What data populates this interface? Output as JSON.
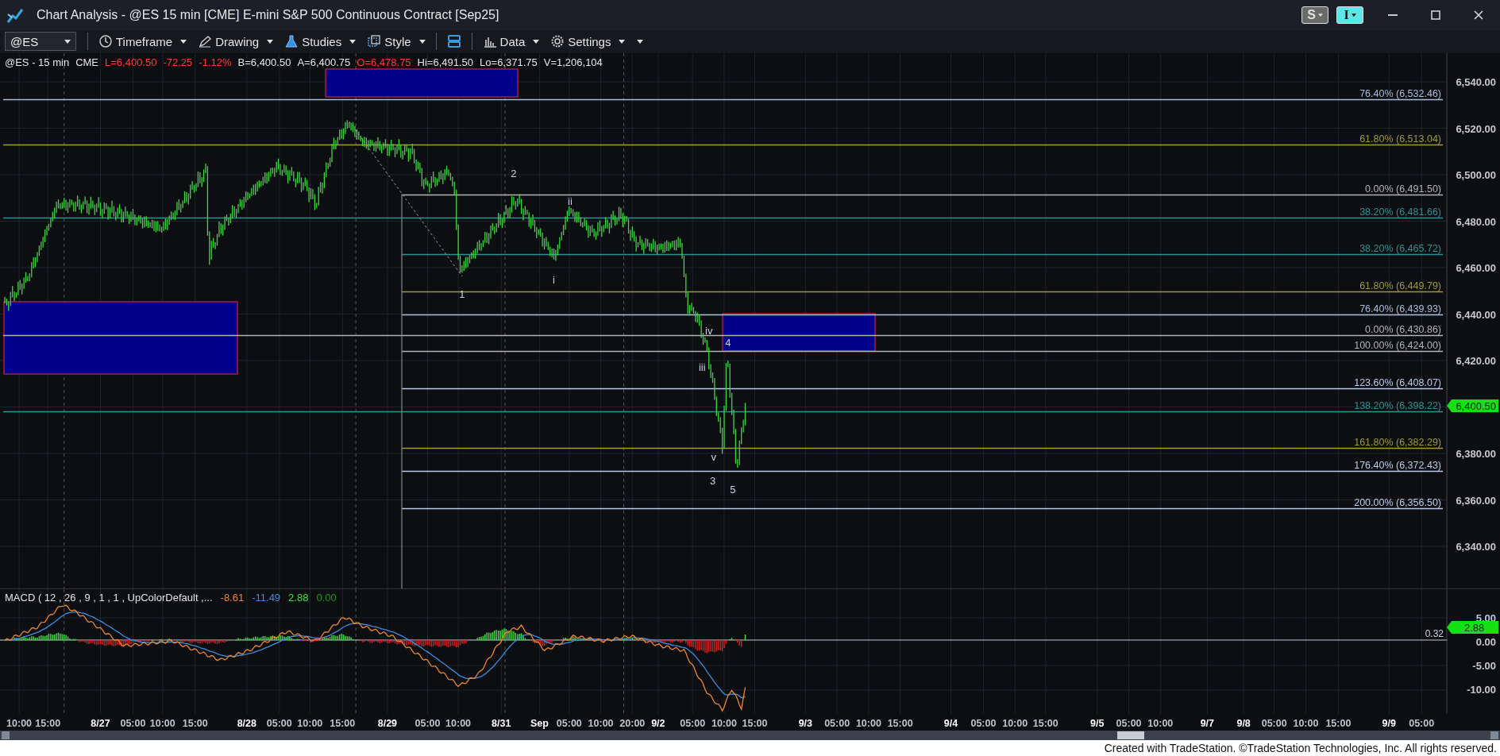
{
  "window": {
    "title": "Chart Analysis - @ES 15 min [CME] E-mini S&P 500 Continuous Contract [Sep25]",
    "buttons": [
      {
        "label": "S",
        "kind": "grey"
      },
      {
        "label": "I",
        "kind": "cyan"
      }
    ]
  },
  "toolbar": {
    "symbol": "@ES",
    "items": [
      {
        "label": "Timeframe",
        "kind": "clock"
      },
      {
        "label": "Drawing",
        "kind": "pen"
      },
      {
        "label": "Studies",
        "kind": "flask"
      },
      {
        "label": "Style",
        "kind": "style"
      },
      {
        "kind": "layout"
      },
      {
        "label": "Data",
        "kind": "data"
      },
      {
        "label": "Settings",
        "kind": "gear"
      }
    ]
  },
  "info_line": [
    {
      "text": "@ES - 15 min",
      "color": "#e6e6e6"
    },
    {
      "text": "CME",
      "color": "#e6e6e6"
    },
    {
      "text": "L=6,400.50",
      "color": "#ff3b3b"
    },
    {
      "text": "-72.25",
      "color": "#ff3b3b"
    },
    {
      "text": "-1.12%",
      "color": "#ff3b3b"
    },
    {
      "text": "B=6,400.50",
      "color": "#e6e6e6"
    },
    {
      "text": "A=6,400.75",
      "color": "#e6e6e6"
    },
    {
      "text": "O=6,478.75",
      "color": "#ff3b3b"
    },
    {
      "text": "Hi=6,491.50",
      "color": "#e6e6e6"
    },
    {
      "text": "Lo=6,371.75",
      "color": "#e6e6e6"
    },
    {
      "text": "V=1,206,104",
      "color": "#e6e6e6"
    }
  ],
  "price_axis": {
    "ticks": [
      "6,540.00",
      "6,520.00",
      "6,500.00",
      "6,480.00",
      "6,460.00",
      "6,440.00",
      "6,420.00",
      "6,380.00",
      "6,360.00",
      "6,340.00"
    ],
    "last_price": "6,400.50"
  },
  "fib_levels": [
    {
      "label": "76.40% (6,532.46)",
      "color": "#a9bcd8",
      "kind": "wide"
    },
    {
      "label": "61.80% (6,513.04)",
      "color": "#a09a30",
      "kind": "wide"
    },
    {
      "label": "0.00% (6,491.50)",
      "color": "#b4b4b4",
      "kind": "partial"
    },
    {
      "label": "38.20% (6,481.66)",
      "color": "#2a9494",
      "kind": "wide"
    },
    {
      "label": "38.20% (6,465.72)",
      "color": "#2a9494",
      "kind": "partial"
    },
    {
      "label": "61.80% (6,449.79)",
      "color": "#a09a30",
      "kind": "partial"
    },
    {
      "label": "76.40% (6,439.93)",
      "color": "#a9bcd8",
      "kind": "partial"
    },
    {
      "label": "0.00% (6,430.86)",
      "color": "#b4b4b4",
      "kind": "wide"
    },
    {
      "label": "100.00% (6,424.00)",
      "color": "#b4b4b4",
      "kind": "partial"
    },
    {
      "label": "123.60% (6,408.07)",
      "color": "#b9cbe6",
      "kind": "partial"
    },
    {
      "label": "138.20% (6,398.22)",
      "color": "#2a9494",
      "kind": "wide"
    },
    {
      "label": "161.80% (6,382.29)",
      "color": "#a09a30",
      "kind": "partial"
    },
    {
      "label": "176.40% (6,372.43)",
      "color": "#b9cbe6",
      "kind": "partial"
    },
    {
      "label": "200.00% (6,356.50)",
      "color": "#b9cbe6",
      "kind": "partial"
    }
  ],
  "wave_labels": [
    "2",
    "ii",
    "1",
    "i",
    "iv",
    "4",
    "iii",
    "v",
    "3",
    "5"
  ],
  "macd": {
    "title": "MACD ( 12 , 26 , 9 , 1 , 1 , UpColorDefault ,...",
    "values": [
      {
        "text": "-8.61",
        "color": "#f0862a"
      },
      {
        "text": "-11.49",
        "color": "#3a8fe0"
      },
      {
        "text": "2.88",
        "color": "#3fe03f"
      },
      {
        "text": "0.00",
        "color": "#1f9a1f"
      }
    ],
    "ticks": [
      "5.00",
      "0.00",
      "-5.00",
      "-10.00"
    ],
    "line_label": "0.32",
    "last_value": "2.88"
  },
  "time_axis": [
    {
      "text": "10:00",
      "kind": "time"
    },
    {
      "text": "15:00",
      "kind": "time"
    },
    {
      "text": "8/27",
      "kind": "date"
    },
    {
      "text": "05:00",
      "kind": "time"
    },
    {
      "text": "10:00",
      "kind": "time"
    },
    {
      "text": "15:00",
      "kind": "time"
    },
    {
      "text": "8/28",
      "kind": "date"
    },
    {
      "text": "05:00",
      "kind": "time"
    },
    {
      "text": "10:00",
      "kind": "time"
    },
    {
      "text": "15:00",
      "kind": "time"
    },
    {
      "text": "8/29",
      "kind": "date"
    },
    {
      "text": "05:00",
      "kind": "time"
    },
    {
      "text": "10:00",
      "kind": "time"
    },
    {
      "text": "8/31",
      "kind": "date"
    },
    {
      "text": "Sep",
      "kind": "date"
    },
    {
      "text": "05:00",
      "kind": "time"
    },
    {
      "text": "10:00",
      "kind": "time"
    },
    {
      "text": "20:00",
      "kind": "time"
    },
    {
      "text": "9/2",
      "kind": "date"
    },
    {
      "text": "05:00",
      "kind": "time"
    },
    {
      "text": "10:00",
      "kind": "time"
    },
    {
      "text": "15:00",
      "kind": "time"
    },
    {
      "text": "9/3",
      "kind": "date"
    },
    {
      "text": "05:00",
      "kind": "time"
    },
    {
      "text": "10:00",
      "kind": "time"
    },
    {
      "text": "15:00",
      "kind": "time"
    },
    {
      "text": "9/4",
      "kind": "date"
    },
    {
      "text": "05:00",
      "kind": "time"
    },
    {
      "text": "10:00",
      "kind": "time"
    },
    {
      "text": "15:00",
      "kind": "time"
    },
    {
      "text": "9/5",
      "kind": "date"
    },
    {
      "text": "05:00",
      "kind": "time"
    },
    {
      "text": "10:00",
      "kind": "time"
    },
    {
      "text": "9/7",
      "kind": "date"
    },
    {
      "text": "9/8",
      "kind": "date"
    },
    {
      "text": "05:00",
      "kind": "time"
    },
    {
      "text": "10:00",
      "kind": "time"
    },
    {
      "text": "15:00",
      "kind": "time"
    },
    {
      "text": "9/9",
      "kind": "date"
    },
    {
      "text": "05:00",
      "kind": "time"
    }
  ],
  "footer": "Created with TradeStation. ©TradeStation Technologies, Inc. All rights reserved."
}
